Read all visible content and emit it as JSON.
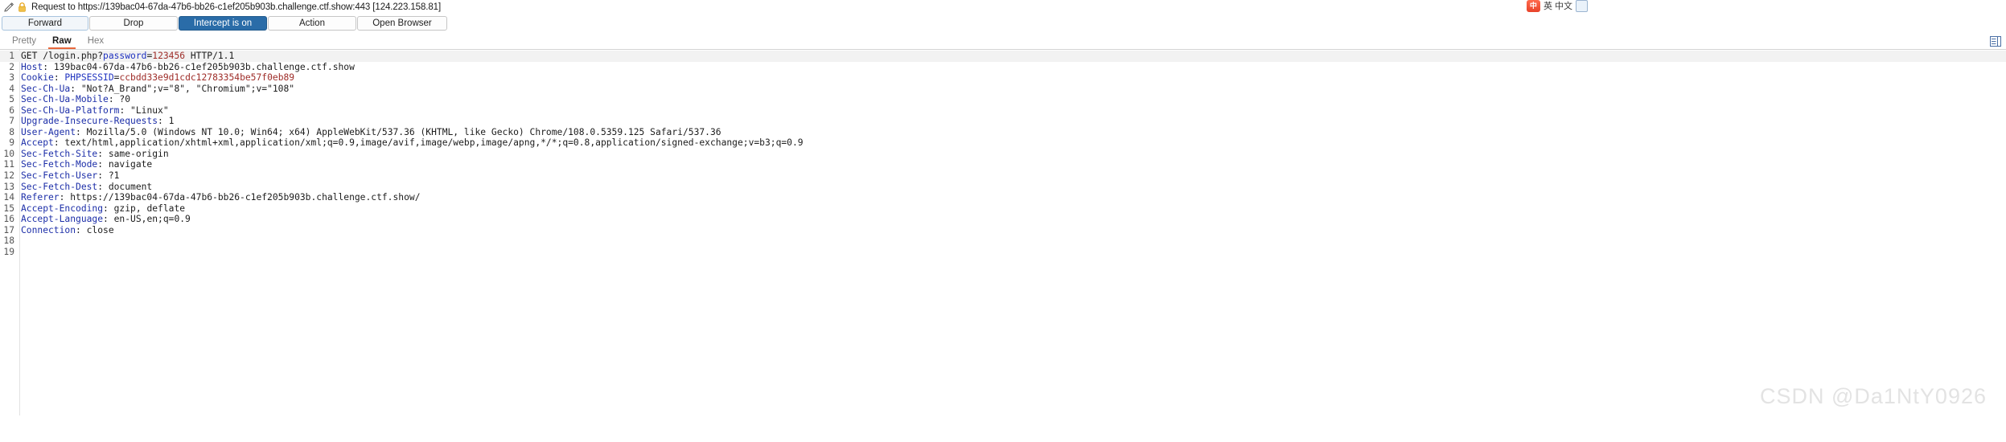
{
  "titlebar": {
    "pencil_icon": "pencil-icon",
    "lock_icon": "lock-icon",
    "text": "Request to https://139bac04-67da-47b6-bb26-c1ef205b903b.challenge.ctf.show:443  [124.223.158.81]",
    "ime": {
      "badge": "中",
      "label": "英 中文",
      "square_icon": "ime-square-icon"
    }
  },
  "toolbar": {
    "forward_label": "Forward",
    "drop_label": "Drop",
    "intercept_label": "Intercept is on",
    "action_label": "Action",
    "open_browser_label": "Open Browser",
    "active_color": "#2a6ca8"
  },
  "tabs": {
    "items": [
      {
        "label": "Pretty",
        "selected": false
      },
      {
        "label": "Raw",
        "selected": true
      },
      {
        "label": "Hex",
        "selected": false
      }
    ],
    "indicator_color": "#e8683c",
    "right_icon": "panel-options-icon"
  },
  "request": {
    "colors": {
      "header_name": "#1c2ea8",
      "param_name": "#2033c0",
      "param_value": "#9e2c28",
      "plain": "#1c1c1c",
      "gutter_text": "#555555",
      "highlight_row": "#f2f2f2"
    },
    "lines": [
      {
        "num": "1",
        "highlighted": true,
        "parts": [
          {
            "text": "GET /login.php?",
            "type": "plain"
          },
          {
            "text": "password",
            "type": "key"
          },
          {
            "text": "=",
            "type": "plain"
          },
          {
            "text": "123456",
            "type": "val"
          },
          {
            "text": " HTTP/1.1",
            "type": "plain"
          }
        ]
      },
      {
        "num": "2",
        "highlighted": false,
        "parts": [
          {
            "text": "Host",
            "type": "hdr"
          },
          {
            "text": ": 139bac04-67da-47b6-bb26-c1ef205b903b.challenge.ctf.show",
            "type": "plain"
          }
        ]
      },
      {
        "num": "3",
        "highlighted": false,
        "parts": [
          {
            "text": "Cookie",
            "type": "hdr"
          },
          {
            "text": ": ",
            "type": "plain"
          },
          {
            "text": "PHPSESSID",
            "type": "key"
          },
          {
            "text": "=",
            "type": "plain"
          },
          {
            "text": "ccbdd33e9d1cdc12783354be57f0eb89",
            "type": "val"
          }
        ]
      },
      {
        "num": "4",
        "highlighted": false,
        "parts": [
          {
            "text": "Sec-Ch-Ua",
            "type": "hdr"
          },
          {
            "text": ": \"Not?A_Brand\";v=\"8\", \"Chromium\";v=\"108\"",
            "type": "plain"
          }
        ]
      },
      {
        "num": "5",
        "highlighted": false,
        "parts": [
          {
            "text": "Sec-Ch-Ua-Mobile",
            "type": "hdr"
          },
          {
            "text": ": ?0",
            "type": "plain"
          }
        ]
      },
      {
        "num": "6",
        "highlighted": false,
        "parts": [
          {
            "text": "Sec-Ch-Ua-Platform",
            "type": "hdr"
          },
          {
            "text": ": \"Linux\"",
            "type": "plain"
          }
        ]
      },
      {
        "num": "7",
        "highlighted": false,
        "parts": [
          {
            "text": "Upgrade-Insecure-Requests",
            "type": "hdr"
          },
          {
            "text": ": 1",
            "type": "plain"
          }
        ]
      },
      {
        "num": "8",
        "highlighted": false,
        "parts": [
          {
            "text": "User-Agent",
            "type": "hdr"
          },
          {
            "text": ": Mozilla/5.0 (Windows NT 10.0; Win64; x64) AppleWebKit/537.36 (KHTML, like Gecko) Chrome/108.0.5359.125 Safari/537.36",
            "type": "plain"
          }
        ]
      },
      {
        "num": "9",
        "highlighted": false,
        "parts": [
          {
            "text": "Accept",
            "type": "hdr"
          },
          {
            "text": ": text/html,application/xhtml+xml,application/xml;q=0.9,image/avif,image/webp,image/apng,*/*;q=0.8,application/signed-exchange;v=b3;q=0.9",
            "type": "plain"
          }
        ]
      },
      {
        "num": "10",
        "highlighted": false,
        "parts": [
          {
            "text": "Sec-Fetch-Site",
            "type": "hdr"
          },
          {
            "text": ": same-origin",
            "type": "plain"
          }
        ]
      },
      {
        "num": "11",
        "highlighted": false,
        "parts": [
          {
            "text": "Sec-Fetch-Mode",
            "type": "hdr"
          },
          {
            "text": ": navigate",
            "type": "plain"
          }
        ]
      },
      {
        "num": "12",
        "highlighted": false,
        "parts": [
          {
            "text": "Sec-Fetch-User",
            "type": "hdr"
          },
          {
            "text": ": ?1",
            "type": "plain"
          }
        ]
      },
      {
        "num": "13",
        "highlighted": false,
        "parts": [
          {
            "text": "Sec-Fetch-Dest",
            "type": "hdr"
          },
          {
            "text": ": document",
            "type": "plain"
          }
        ]
      },
      {
        "num": "14",
        "highlighted": false,
        "parts": [
          {
            "text": "Referer",
            "type": "hdr"
          },
          {
            "text": ": https://139bac04-67da-47b6-bb26-c1ef205b903b.challenge.ctf.show/",
            "type": "plain"
          }
        ]
      },
      {
        "num": "15",
        "highlighted": false,
        "parts": [
          {
            "text": "Accept-Encoding",
            "type": "hdr"
          },
          {
            "text": ": gzip, deflate",
            "type": "plain"
          }
        ]
      },
      {
        "num": "16",
        "highlighted": false,
        "parts": [
          {
            "text": "Accept-Language",
            "type": "hdr"
          },
          {
            "text": ": en-US,en;q=0.9",
            "type": "plain"
          }
        ]
      },
      {
        "num": "17",
        "highlighted": false,
        "parts": [
          {
            "text": "Connection",
            "type": "hdr"
          },
          {
            "text": ": close",
            "type": "plain"
          }
        ]
      },
      {
        "num": "18",
        "highlighted": false,
        "parts": []
      },
      {
        "num": "19",
        "highlighted": false,
        "parts": []
      }
    ]
  },
  "watermark": {
    "text": "CSDN @Da1NtY0926"
  }
}
